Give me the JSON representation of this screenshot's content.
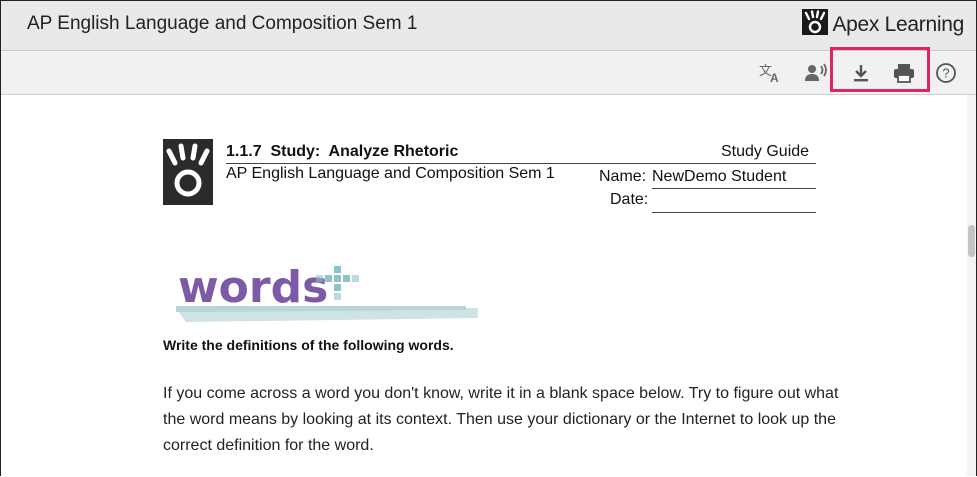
{
  "window": {
    "title": "AP English Language and Composition Sem 1",
    "brand": "Apex Learning"
  },
  "toolbar": {
    "icons": [
      "translate-icon",
      "text-to-speech-icon",
      "download-icon",
      "print-icon",
      "help-icon"
    ],
    "highlight_color": "#e0245e"
  },
  "document": {
    "lesson_number": "1.1.7",
    "lesson_title": "Study:  Analyze Rhetoric",
    "doc_type": "Study Guide",
    "course": "AP English Language and Composition Sem 1",
    "name_label": "Name:",
    "name_value": "NewDemo Student",
    "date_label": "Date:",
    "section_logo_text": "words",
    "instruction": "Write the definitions of the following words.",
    "paragraph": "If you come across a word you don't know, write it in a blank space below. Try to figure out what the word means by looking at its context. Then use your dictionary or the Internet to look up the correct definition for the word."
  },
  "colors": {
    "words_purple": "#7d5aa6",
    "words_teal": "#8ec3c9"
  }
}
